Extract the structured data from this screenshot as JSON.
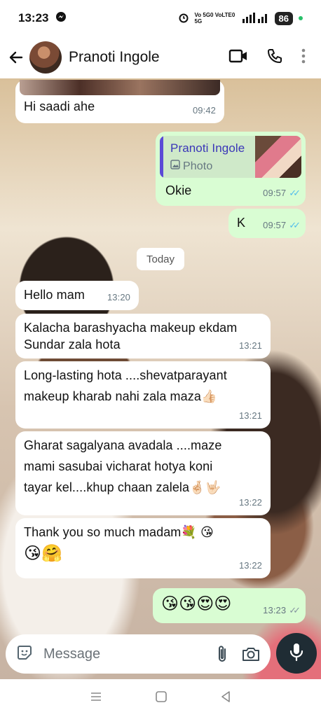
{
  "status_bar": {
    "time": "13:23",
    "network_label": "Vo 5G0 VoLTE0 5G",
    "battery": "86"
  },
  "header": {
    "contact_name": "Pranoti Ingole",
    "icons": [
      "back-arrow-icon",
      "video-call-icon",
      "voice-call-icon",
      "more-vert-icon"
    ]
  },
  "messages": [
    {
      "dir": "in",
      "text": "Hi saadi ahe",
      "time": "09:42"
    },
    {
      "dir": "out",
      "quote_name": "Pranoti Ingole",
      "quote_type": "Photo",
      "text": "Okie",
      "time": "09:57",
      "read": true
    },
    {
      "dir": "out",
      "text": "K",
      "time": "09:57",
      "read": true
    },
    {
      "dir": "in",
      "text": "Hello mam",
      "time": "13:20"
    },
    {
      "dir": "in",
      "text_line1": "Kalacha barashyacha makeup ekdam",
      "text_line2": "Sundar zala hota",
      "time": "13:21"
    },
    {
      "dir": "in",
      "text_line1": "Long-lasting hota ....shevatparayant",
      "text_line2": "makeup kharab nahi zala maza👍🏻",
      "time": "13:21"
    },
    {
      "dir": "in",
      "text_line1": "Gharat sagalyana avadala ....maze",
      "text_line2": "mami sasubai vicharat hotya koni",
      "text_line3": "tayar kel....khup chaan zalela🤞🏻🤟🏻",
      "time": "13:22"
    },
    {
      "dir": "in",
      "text_line1": "Thank you so much madam💐 😘",
      "text_line2": "😘🤗",
      "time": "13:22"
    },
    {
      "dir": "out",
      "text": "😘😘😍😍",
      "time": "13:23",
      "read": false
    }
  ],
  "date_divider": "Today",
  "composer": {
    "placeholder": "Message",
    "icons": [
      "sticker-icon",
      "attach-icon",
      "camera-icon",
      "mic-icon"
    ]
  },
  "colors": {
    "incoming": "#ffffff",
    "outgoing": "#d9fdd3",
    "read_ticks": "#53bdeb",
    "mic_button": "#1f2c34"
  }
}
